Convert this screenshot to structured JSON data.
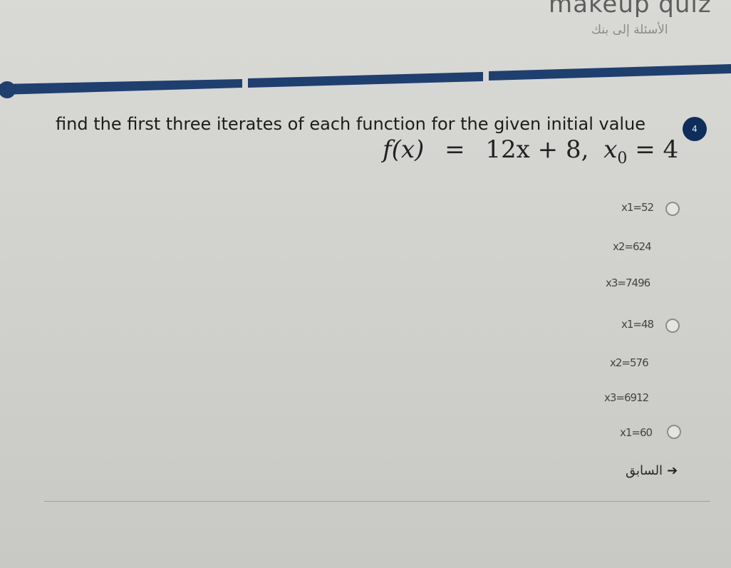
{
  "header": {
    "title": "makeup quiz",
    "subtitle": "الأسئلة إلى بنك"
  },
  "progress": {
    "color": "#1f3f6e",
    "segments": 3
  },
  "question": {
    "number": "4",
    "text": "find the first three iterates of each function for the given initial value",
    "formula": {
      "fx": "f(x)",
      "eq": "=",
      "expr": "12x + 8,",
      "x0": "x",
      "x0_sub": "0",
      "x0_eq": "= 4"
    }
  },
  "options": [
    {
      "lines": [
        "x1=52"
      ],
      "has_radio": true
    },
    {
      "lines": [
        "x2=624"
      ],
      "has_radio": false
    },
    {
      "lines": [
        "x3=7496"
      ],
      "has_radio": false
    },
    {
      "lines": [
        "x1=48"
      ],
      "has_radio": true
    },
    {
      "lines": [
        "x2=576"
      ],
      "has_radio": false
    },
    {
      "lines": [
        "x3=6912"
      ],
      "has_radio": false
    },
    {
      "lines": [
        "x1=60"
      ],
      "has_radio": true
    }
  ],
  "nav": {
    "back_label": "السابق",
    "back_icon": "arrow-right-icon"
  },
  "labels": {
    "opt1_line1": "x1=52",
    "opt1_line2": "x2=624",
    "opt1_line3": "x3=7496",
    "opt2_line1": "x1=48",
    "opt2_line2": "x2=576",
    "opt2_line3": "x3=6912",
    "opt3_line1": "x1=60"
  }
}
